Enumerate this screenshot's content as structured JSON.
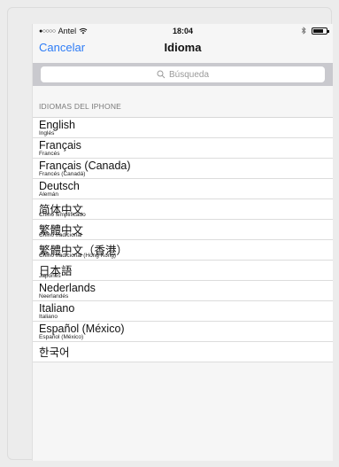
{
  "status_bar": {
    "signal": "●○○○○",
    "carrier": "Antel",
    "time": "18:04"
  },
  "nav": {
    "cancel_label": "Cancelar",
    "title": "Idioma"
  },
  "search": {
    "placeholder": "Búsqueda"
  },
  "section": {
    "header": "IDIOMAS DEL IPHONE"
  },
  "languages": [
    {
      "name": "English",
      "translation": "Inglés"
    },
    {
      "name": "Français",
      "translation": "Francés"
    },
    {
      "name": "Français (Canada)",
      "translation": "Francés (Canadá)"
    },
    {
      "name": "Deutsch",
      "translation": "Alemán"
    },
    {
      "name": "简体中文",
      "translation": "Chino simplificado"
    },
    {
      "name": "繁體中文",
      "translation": "Chino tradicional"
    },
    {
      "name": "繁體中文（香港）",
      "translation": "Chino tradicional (Hong Kong)"
    },
    {
      "name": "日本語",
      "translation": "Japonés"
    },
    {
      "name": "Nederlands",
      "translation": "Neerlandés"
    },
    {
      "name": "Italiano",
      "translation": "Italiano"
    },
    {
      "name": "Español (México)",
      "translation": "Español (México)"
    },
    {
      "name": "한국어",
      "translation": ""
    }
  ],
  "icons": {
    "wifi": "wifi-icon",
    "bluetooth": "bluetooth-icon",
    "battery": "battery-icon",
    "search": "search-icon"
  },
  "colors": {
    "accent": "#2d7cf6",
    "search_bar_bg": "#c9c9ce"
  }
}
